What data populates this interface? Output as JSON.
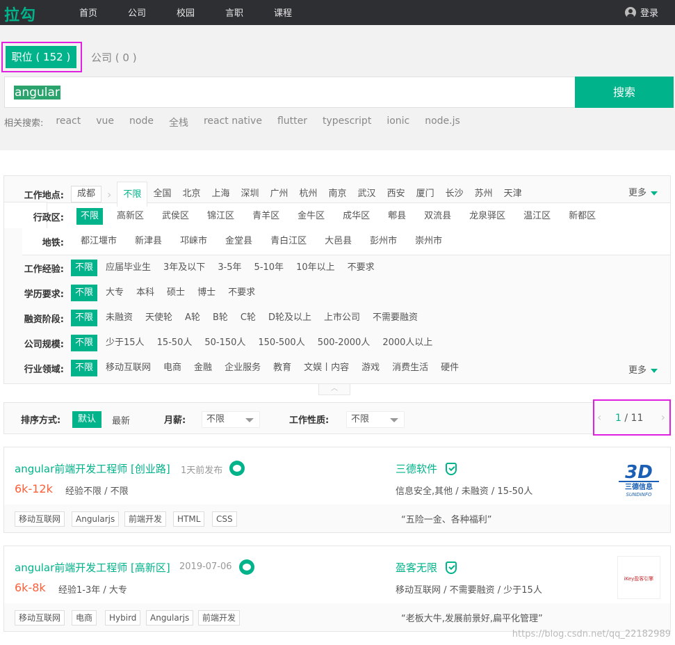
{
  "nav": {
    "logo": "拉勾",
    "items": [
      "首页",
      "公司",
      "校园",
      "言职",
      "课程"
    ],
    "login": "登录"
  },
  "search": {
    "tab_jobs": "职位 ( 152 )",
    "tab_company": "公司 ( 0 )",
    "query": "angular",
    "button": "搜索",
    "related_label": "相关搜索:",
    "related": [
      "react",
      "vue",
      "node",
      "全栈",
      "react native",
      "flutter",
      "typescript",
      "ionic",
      "node.js"
    ]
  },
  "filters": {
    "location_label": "工作地点:",
    "city": "成都",
    "cities": [
      "不限",
      "全国",
      "北京",
      "上海",
      "深圳",
      "广州",
      "杭州",
      "南京",
      "武汉",
      "西安",
      "厦门",
      "长沙",
      "苏州",
      "天津"
    ],
    "more": "更多",
    "district_label": "行政区:",
    "districts": [
      "不限",
      "高新区",
      "武侯区",
      "锦江区",
      "青羊区",
      "金牛区",
      "成华区",
      "郫县",
      "双流县",
      "龙泉驿区",
      "温江区",
      "新都区"
    ],
    "metro_label": "地铁:",
    "metro": [
      "都江堰市",
      "新津县",
      "邛崃市",
      "金堂县",
      "青白江区",
      "大邑县",
      "彭州市",
      "崇州市"
    ],
    "experience_label": "工作经验:",
    "experience": [
      "不限",
      "应届毕业生",
      "3年及以下",
      "3-5年",
      "5-10年",
      "10年以上",
      "不要求"
    ],
    "education_label": "学历要求:",
    "education": [
      "不限",
      "大专",
      "本科",
      "硕士",
      "博士",
      "不要求"
    ],
    "funding_label": "融资阶段:",
    "funding": [
      "不限",
      "未融资",
      "天使轮",
      "A轮",
      "B轮",
      "C轮",
      "D轮及以上",
      "上市公司",
      "不需要融资"
    ],
    "size_label": "公司规模:",
    "size": [
      "不限",
      "少于15人",
      "15-50人",
      "50-150人",
      "150-500人",
      "500-2000人",
      "2000人以上"
    ],
    "industry_label": "行业领域:",
    "industry": [
      "不限",
      "移动互联网",
      "电商",
      "金融",
      "企业服务",
      "教育",
      "文娱丨内容",
      "游戏",
      "消费生活",
      "硬件"
    ]
  },
  "sort": {
    "label": "排序方式:",
    "default": "默认",
    "newest": "最新",
    "salary_label": "月薪:",
    "salary_value": "不限",
    "nature_label": "工作性质:",
    "nature_value": "不限",
    "page_current": "1",
    "page_total": "/ 11"
  },
  "jobs": [
    {
      "title": "angular前端开发工程师 [创业路]",
      "time": "1天前发布",
      "salary": "6k-12k",
      "req": "经验不限 / 不限",
      "company": "三德软件",
      "company_info": "信息安全,其他 / 未融资 / 15-50人",
      "tags": [
        "移动互联网",
        "Angularjs",
        "前端开发",
        "HTML",
        "CSS"
      ],
      "slogan": "“五险一金、各种福利”",
      "logo_text": "三德信息",
      "logo_sub": "SUNDINFO"
    },
    {
      "title": "angular前端开发工程师 [高新区]",
      "time": "2019-07-06",
      "salary": "6k-8k",
      "req": "经验1-3年 / 大专",
      "company": "盈客无限",
      "company_info": "移动互联网 / 不需要融资 / 少于15人",
      "tags": [
        "移动互联网",
        "电商",
        "Hybird",
        "Angularjs",
        "前端开发"
      ],
      "slogan": "“老板大牛,发展前景好,扁平化管理”",
      "logo_text": "iKey盈客引擎"
    }
  ],
  "watermark": "https://blog.csdn.net/qq_22182989",
  "colors": {
    "accent": "#00b38a",
    "salary": "#fd5f39",
    "nav_bg": "#2d2f33",
    "highlight": "#e020e0"
  }
}
